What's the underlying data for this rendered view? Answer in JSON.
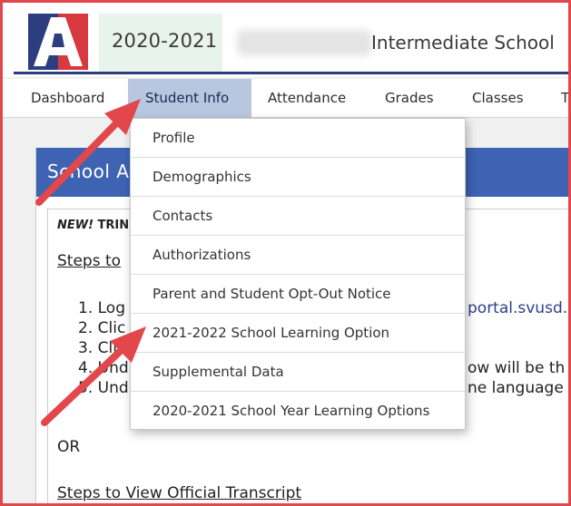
{
  "header": {
    "logo_letter": "A",
    "school_year": "2020-2021",
    "school_name": "Intermediate School",
    "colors": {
      "navy": "#2d3e80",
      "red": "#d63a3f",
      "year_bg": "#e8f3ee"
    }
  },
  "nav": {
    "items": [
      {
        "label": "Dashboard"
      },
      {
        "label": "Student Info"
      },
      {
        "label": "Attendance"
      },
      {
        "label": "Grades"
      },
      {
        "label": "Classes"
      },
      {
        "label": "T"
      }
    ],
    "active": "Student Info"
  },
  "dropdown": {
    "items": [
      {
        "label": "Profile"
      },
      {
        "label": "Demographics"
      },
      {
        "label": "Contacts"
      },
      {
        "label": "Authorizations"
      },
      {
        "label": "Parent and Student Opt-Out Notice"
      },
      {
        "label": "2021-2022 School Learning Option"
      },
      {
        "label": "Supplemental Data"
      },
      {
        "label": "2020-2021 School Year Learning Options"
      }
    ]
  },
  "panel": {
    "title": "School A",
    "intro_new": "NEW!",
    "intro_rest": " TRIN",
    "steps_heading": "Steps to",
    "steps": [
      "1. Log",
      "2. Clic",
      "3. Clic",
      "4. Und",
      "5. Und"
    ],
    "step1_link": "portal.svusd.",
    "step4_tail": "ow will be th",
    "step5_tail": "ne language",
    "or_text": "OR",
    "transcript_heading": "Steps to View Official Transcript"
  },
  "annotations": {
    "arrow_color": "#e2474b",
    "arrow_count": 2
  }
}
